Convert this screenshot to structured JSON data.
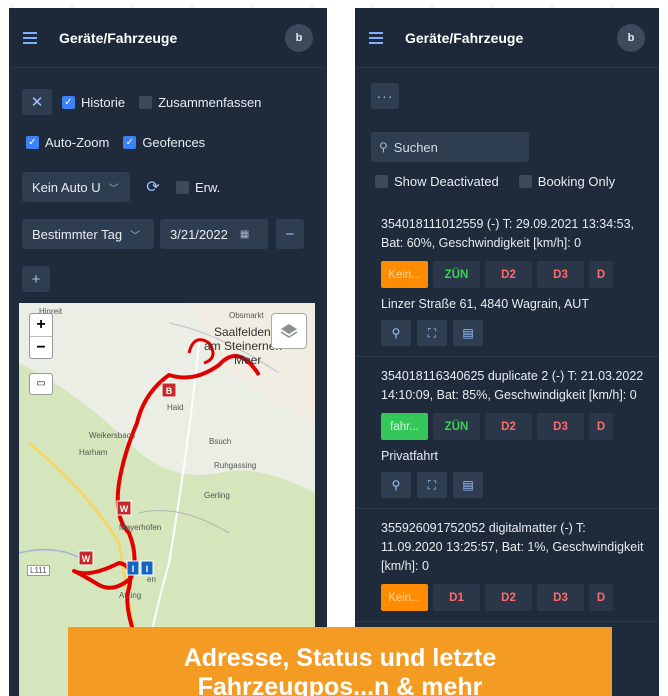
{
  "left_panel": {
    "title": "Geräte/Fahrzeuge",
    "avatar_initial": "b",
    "close_icon": "close-icon",
    "historie_label": "Historie",
    "zusammenfassen_label": "Zusammenfassen",
    "autozoom_label": "Auto-Zoom",
    "geofences_label": "Geofences",
    "vehicle_select_value": "Kein Auto U",
    "erw_label": "Erw.",
    "day_select_value": "Bestimmter Tag",
    "date_value": "3/21/2022",
    "minus_label": "−",
    "plus_label": "+",
    "map": {
      "labels": {
        "hinreit": "Hinreit",
        "obsmarkt": "Obsmarkt",
        "saalfelden": "Saalfelden",
        "am_steinernen": "am Steinernen",
        "meer": "Meer",
        "haid": "Haid",
        "weikersbach": "Weikersbach",
        "bsuch": "Bsuch",
        "harham": "Harham",
        "ruhgassing": "Ruhgassing",
        "gerling": "Gerling",
        "maerzenhofen": "Mayerhofen",
        "l111": "L111",
        "atzing": "Atzing",
        "en": "en"
      },
      "markers": {
        "b": "B",
        "w": "W",
        "i": "I"
      },
      "zoom_in": "+",
      "zoom_out": "−",
      "route_color": "#e00000"
    }
  },
  "right_panel": {
    "title": "Geräte/Fahrzeuge",
    "avatar_initial": "b",
    "more_label": "···",
    "search_placeholder": "Suchen",
    "show_deactivated_label": "Show Deactivated",
    "booking_only_label": "Booking Only",
    "devices": [
      {
        "info": "354018111012559 (-) T: 29.09.2021 13:34:53, Bat: 60%, Geschwindigkeit [km/h]: 0",
        "chips": [
          "Kein...",
          "ZÜN",
          "D2",
          "D3",
          "D"
        ],
        "address": "Linzer Straße 61, 4840 Wagrain, AUT"
      },
      {
        "info": "354018116340625 duplicate 2 (-) T: 21.03.2022 14:10:09, Bat: 85%, Geschwindigkeit [km/h]: 0",
        "chips": [
          "fahr...",
          "ZÜN",
          "D2",
          "D3",
          "D"
        ],
        "address": "Privatfahrt"
      },
      {
        "info": "355926091752052 digitalmatter (-) T: 11.09.2020 13:25:57, Bat: 1%, Geschwindigkeit [km/h]: 0",
        "chips": [
          "Kein...",
          "D1",
          "D2",
          "D3",
          "D"
        ]
      }
    ]
  },
  "overlay": {
    "line1": "Adresse, Status und letzte",
    "line2": "Fahrzeugpos...n & mehr"
  },
  "colors": {
    "panel_bg": "#1f2b3a",
    "accent_blue": "#3b82f6",
    "orange": "#ff8c00",
    "green": "#34c759",
    "red_text": "#ff6b6b",
    "overlay": "#f49b24"
  }
}
